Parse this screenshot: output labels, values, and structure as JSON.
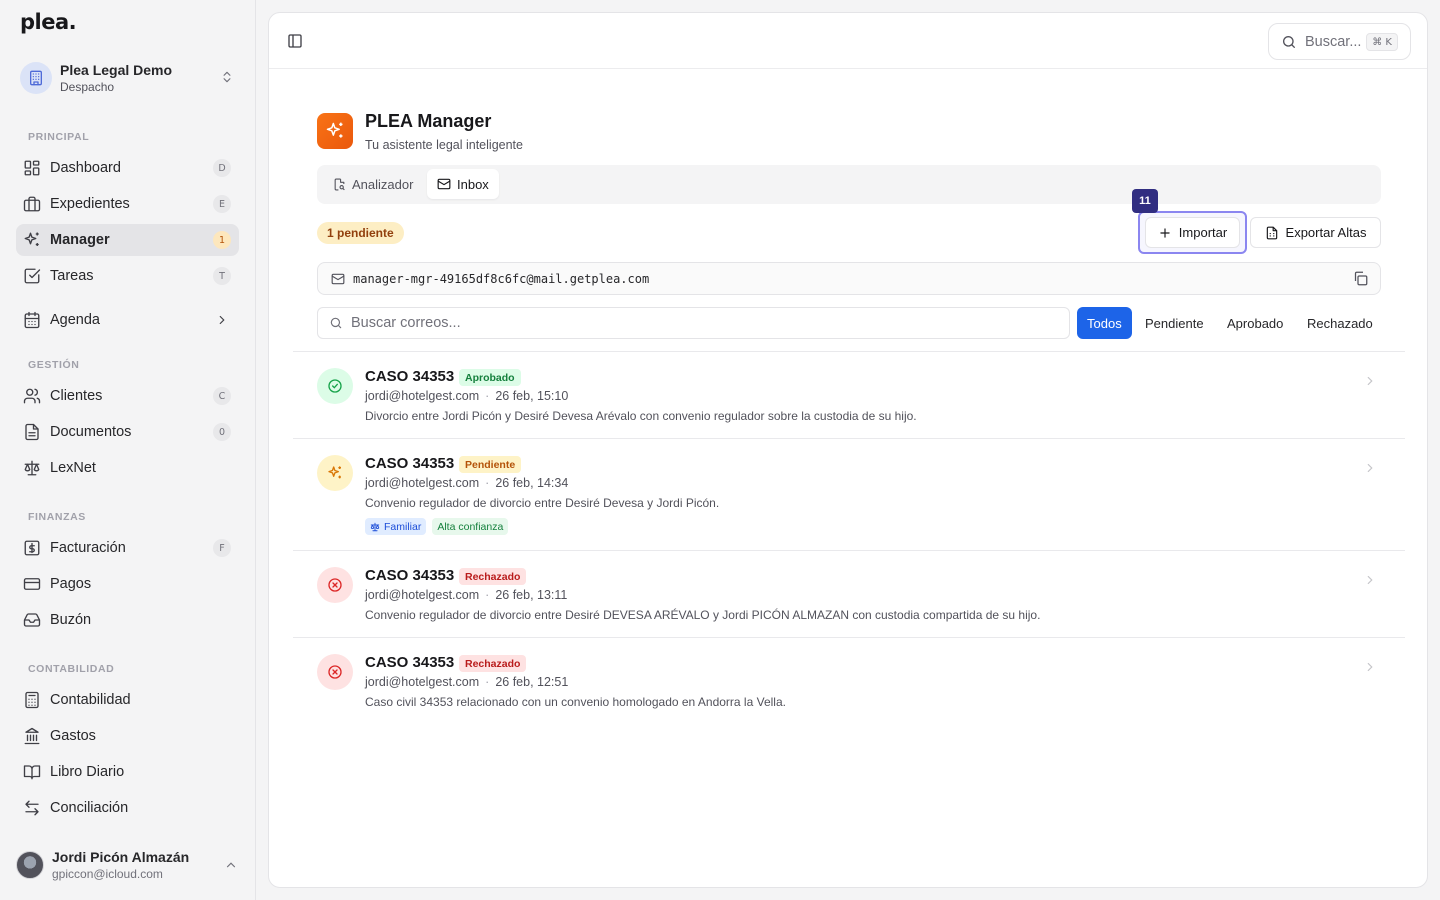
{
  "app": {
    "logo": "plea."
  },
  "workspace": {
    "name": "Plea Legal Demo",
    "type": "Despacho"
  },
  "sidebar": {
    "sections": {
      "principal": "PRINCIPAL",
      "gestion": "GESTIÓN",
      "finanzas": "FINANZAS",
      "contabilidad": "CONTABILIDAD"
    },
    "items": {
      "dashboard": {
        "label": "Dashboard",
        "key": "D"
      },
      "expedientes": {
        "label": "Expedientes",
        "key": "E"
      },
      "manager": {
        "label": "Manager",
        "badge": "1"
      },
      "tareas": {
        "label": "Tareas",
        "key": "T"
      },
      "agenda": {
        "label": "Agenda"
      },
      "clientes": {
        "label": "Clientes",
        "key": "C"
      },
      "documentos": {
        "label": "Documentos",
        "key": "0"
      },
      "lexnet": {
        "label": "LexNet"
      },
      "facturacion": {
        "label": "Facturación",
        "key": "F"
      },
      "pagos": {
        "label": "Pagos"
      },
      "buzon": {
        "label": "Buzón"
      },
      "contabilidad": {
        "label": "Contabilidad"
      },
      "gastos": {
        "label": "Gastos"
      },
      "libro_diario": {
        "label": "Libro Diario"
      },
      "conciliacion": {
        "label": "Conciliación"
      }
    }
  },
  "user": {
    "name": "Jordi Picón Almazán",
    "email": "gpiccon@icloud.com"
  },
  "topbar": {
    "search_label": "Buscar...",
    "search_shortcut": "⌘ K"
  },
  "page": {
    "title": "PLEA Manager",
    "subtitle": "Tu asistente legal inteligente",
    "tabs": {
      "analizador": "Analizador",
      "inbox": "Inbox"
    },
    "pending_count": "1 pendiente",
    "counter_badge": "11",
    "import_label": "Importar",
    "export_label": "Exportar Altas",
    "inbox_email": "manager-mgr-49165df8c6fc@mail.getplea.com",
    "search_placeholder": "Buscar correos...",
    "filters": {
      "todos": "Todos",
      "pendiente": "Pendiente",
      "aprobado": "Aprobado",
      "rechazado": "Rechazado"
    }
  },
  "emails": [
    {
      "title": "CASO 34353",
      "status": "Aprobado",
      "from": "jordi@hotelgest.com",
      "date": "26 feb, 15:10",
      "description": "Divorcio entre Jordi Picón y Desiré Devesa Arévalo con convenio regulador sobre la custodia de su hijo."
    },
    {
      "title": "CASO 34353",
      "status": "Pendiente",
      "from": "jordi@hotelgest.com",
      "date": "26 feb, 14:34",
      "description": "Convenio regulador de divorcio entre Desiré Devesa y Jordi Picón.",
      "tags": [
        "Familiar",
        "Alta confianza"
      ]
    },
    {
      "title": "CASO 34353",
      "status": "Rechazado",
      "from": "jordi@hotelgest.com",
      "date": "26 feb, 13:11",
      "description": "Convenio regulador de divorcio entre Desiré DEVESA ARÉVALO y Jordi PICÓN ALMAZAN con custodia compartida de su hijo."
    },
    {
      "title": "CASO 34353",
      "status": "Rechazado",
      "from": "jordi@hotelgest.com",
      "date": "26 feb, 12:51",
      "description": "Caso civil 34353 relacionado con un convenio homologado en Andorra la Vella."
    }
  ],
  "colors": {
    "accent": "#1d64e8",
    "brand_orange": "#f97316",
    "approved": "#15803d",
    "pending": "#b45309",
    "rejected": "#b91c1c"
  }
}
